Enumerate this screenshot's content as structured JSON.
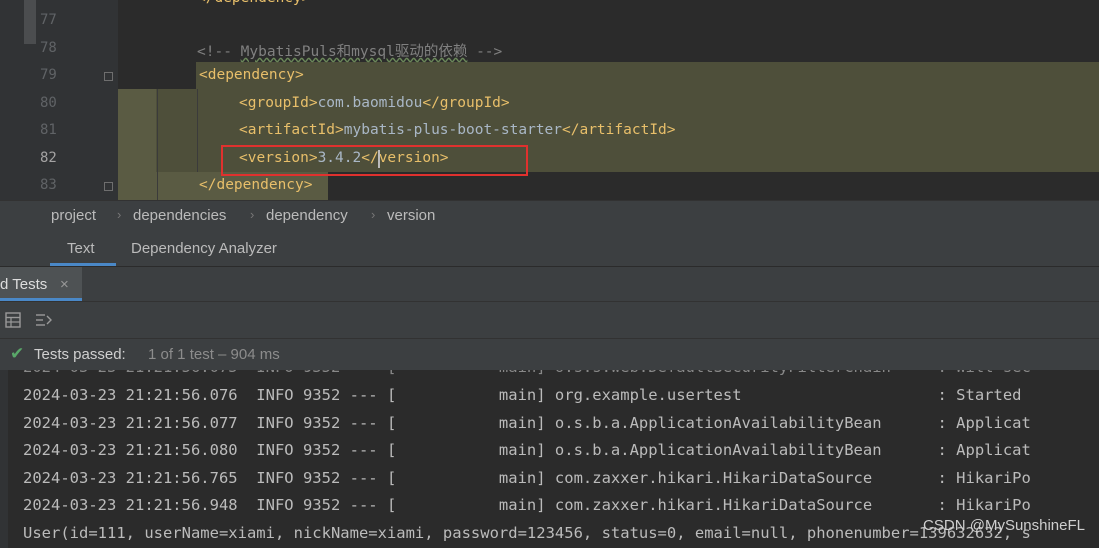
{
  "editor": {
    "line_numbers": [
      "77",
      "78",
      "79",
      "80",
      "81",
      "82",
      "83"
    ],
    "comment_open": "<!-- ",
    "comment_text": "MybatisPuls和mysql驱动的依赖",
    "comment_close": " -->",
    "dependency_open": "<dependency>",
    "groupId_open": "<groupId>",
    "groupId_value": "com.baomidou",
    "groupId_close": "</groupId>",
    "artifactId_open": "<artifactId>",
    "artifactId_value": "mybatis-plus-boot-starter",
    "artifactId_close": "</artifactId>",
    "version_open": "<version>",
    "version_value": "3.4.2",
    "version_close": "</version>",
    "dependency_close": "</dependency>"
  },
  "breadcrumb": [
    "project",
    "dependencies",
    "dependency",
    "version"
  ],
  "editor_tabs": [
    "Text",
    "Dependency Analyzer"
  ],
  "run_panel": {
    "tab_title": "d Tests",
    "close_glyph": "×",
    "status_label": "Tests passed:",
    "status_count": "1 of 1 test – 904 ms"
  },
  "console_lines": [
    "2024-03-23 21:21:56.076  INFO 9352 --- [           main] org.example.usertest                     : Started",
    "2024-03-23 21:21:56.077  INFO 9352 --- [           main] o.s.b.a.ApplicationAvailabilityBean      : Applicat",
    "2024-03-23 21:21:56.080  INFO 9352 --- [           main] o.s.b.a.ApplicationAvailabilityBean      : Applicat",
    "2024-03-23 21:21:56.765  INFO 9352 --- [           main] com.zaxxer.hikari.HikariDataSource       : HikariPo",
    "2024-03-23 21:21:56.948  INFO 9352 --- [           main] com.zaxxer.hikari.HikariDataSource       : HikariPo",
    "User(id=111, userName=xiami, nickName=xiami, password=123456, status=0, email=null, phonenumber=139632632, s"
  ],
  "watermark": "CSDN @MySunshineFL",
  "colors": {
    "tag": "#e8bf6a",
    "text": "#a9b7c6",
    "comment": "#808080",
    "highlight": "#4e4f3a",
    "red_box": "#e0312e",
    "check": "#59a869",
    "accent": "#4a88c7"
  }
}
